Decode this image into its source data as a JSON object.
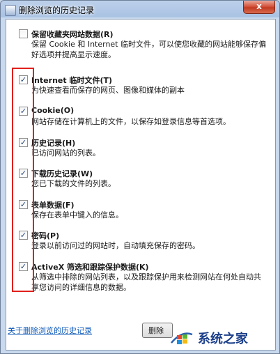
{
  "window": {
    "title": "删除浏览的历史记录",
    "close_label": "x"
  },
  "options": [
    {
      "title": "保留收藏夹网站数据(R)",
      "desc": "保留 Cookie 和 Internet 临时文件，可以使您收藏的网站能够保存偏好选项并提高显示速度。",
      "checked": false
    },
    {
      "title": "Internet 临时文件(T)",
      "desc": "为快速查看而保存的网页、图像和媒体的副本",
      "checked": true
    },
    {
      "title": "Cookie(O)",
      "desc": "网站存储在计算机上的文件，以保存如登录信息等首选项。",
      "checked": true
    },
    {
      "title": "历史记录(H)",
      "desc": "已访问网站的列表。",
      "checked": true
    },
    {
      "title": "下载历史记录(W)",
      "desc": "您已下载的文件的列表。",
      "checked": true
    },
    {
      "title": "表单数据(F)",
      "desc": "保存在表单中键入的信息。",
      "checked": true
    },
    {
      "title": "密码(P)",
      "desc": "登录以前访问过的网站时，自动填充保存的密码。",
      "checked": true
    },
    {
      "title": "ActiveX 筛选和跟踪保护数据(K)",
      "desc": "从筛选中排除的网站列表，以及跟踪保护用来检测网站在何处自动共享您访问的详细信息的数据。",
      "checked": true
    }
  ],
  "footer": {
    "link": "关于删除浏览的历史记录",
    "delete_button": "删除"
  },
  "watermark": {
    "text": "系统之家"
  },
  "colors": {
    "accent": "#0b57b8",
    "highlight": "#e0201c"
  }
}
